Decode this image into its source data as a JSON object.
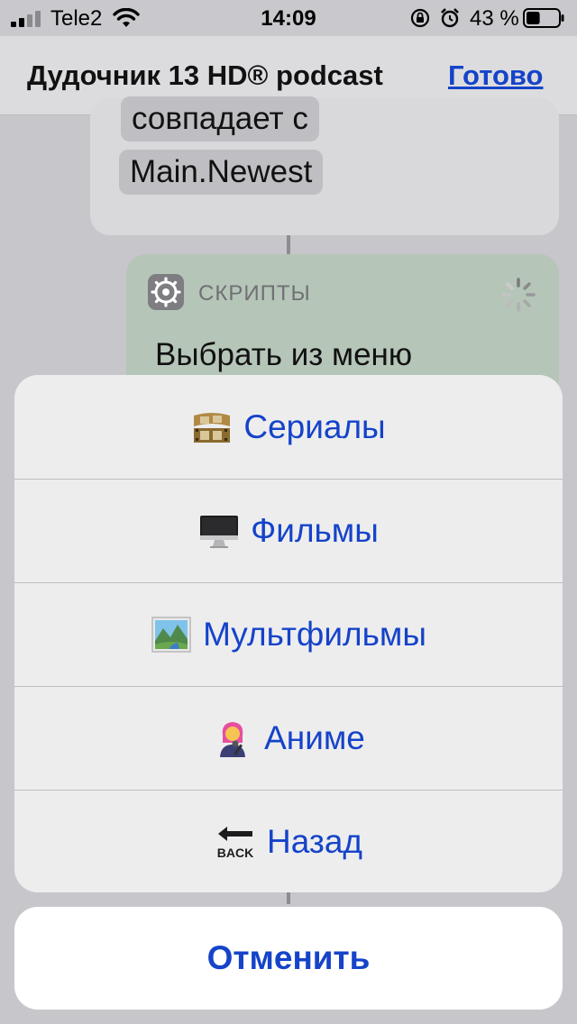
{
  "status_bar": {
    "carrier": "Tele2",
    "time": "14:09",
    "battery_percent": "43 %",
    "battery_level": 0.43
  },
  "nav": {
    "title": "Дудочник 13 HD® podcast",
    "done_label": "Готово"
  },
  "editor": {
    "token_line1": "совпадает с",
    "token_line2": "Main.Newest",
    "script_category": "СКРИПТЫ",
    "script_title": "Выбрать из меню"
  },
  "action_sheet": {
    "items": [
      {
        "label": "Сериалы",
        "icon": "film-reel-icon"
      },
      {
        "label": "Фильмы",
        "icon": "desktop-computer-icon"
      },
      {
        "label": "Мультфильмы",
        "icon": "landscape-picture-icon"
      },
      {
        "label": "Аниме",
        "icon": "singer-woman-icon"
      },
      {
        "label": "Назад",
        "icon": "back-arrow-icon"
      }
    ],
    "cancel_label": "Отменить"
  },
  "colors": {
    "accent": "#1543c9",
    "sheet_bg": "#ededee",
    "script_card": "#b5c5b8"
  }
}
